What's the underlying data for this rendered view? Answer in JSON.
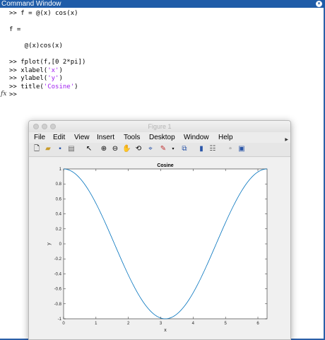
{
  "command_window": {
    "title": "Command Window",
    "lines": [
      {
        "prompt": ">> ",
        "code": "f = @(x) cos(x)",
        "str": ""
      },
      {
        "prompt": "",
        "code": "",
        "str": ""
      },
      {
        "prompt": "",
        "code": "f =",
        "str": ""
      },
      {
        "prompt": "",
        "code": "",
        "str": ""
      },
      {
        "prompt": "",
        "code": "    @(x)cos(x)",
        "str": ""
      },
      {
        "prompt": "",
        "code": "",
        "str": ""
      },
      {
        "prompt": ">> ",
        "code": "fplot(f,[0 2*pi])",
        "str": ""
      },
      {
        "prompt": ">> ",
        "code": "xlabel(",
        "str": "'x'",
        "tail": ")"
      },
      {
        "prompt": ">> ",
        "code": "ylabel(",
        "str": "'y'",
        "tail": ")"
      },
      {
        "prompt": ">> ",
        "code": "title(",
        "str": "'Cosine'",
        "tail": ")"
      },
      {
        "prompt": ">> ",
        "code": "",
        "str": ""
      }
    ],
    "fx_label": "fx"
  },
  "figure": {
    "title": "Figure 1",
    "menu": [
      "File",
      "Edit",
      "View",
      "Insert",
      "Tools",
      "Desktop",
      "Window",
      "Help"
    ],
    "toolbar_icons": [
      "new-figure-icon",
      "open-file-icon",
      "save-icon",
      "print-icon",
      "edit-plot-arrow-icon",
      "zoom-in-icon",
      "zoom-out-icon",
      "pan-hand-icon",
      "rotate-3d-icon",
      "data-cursor-icon",
      "brush-icon",
      "link-plot-icon",
      "colorbar-icon",
      "legend-icon",
      "hide-plot-tools-icon",
      "show-plot-tools-icon"
    ]
  },
  "chart_data": {
    "type": "line",
    "title": "Cosine",
    "xlabel": "x",
    "ylabel": "y",
    "xlim": [
      0,
      6.2832
    ],
    "ylim": [
      -1,
      1
    ],
    "xticks": [
      0,
      1,
      2,
      3,
      4,
      5,
      6
    ],
    "yticks": [
      -1,
      -0.8,
      -0.6,
      -0.4,
      -0.2,
      0,
      0.2,
      0.4,
      0.6,
      0.8,
      1
    ],
    "grid": false,
    "function": "cos(x)",
    "series": [
      {
        "color": "#0072bd",
        "x": [
          0,
          0.5,
          1,
          1.5,
          2,
          2.5,
          3,
          3.1416,
          3.5,
          4,
          4.5,
          5,
          5.5,
          6,
          6.2832
        ],
        "y": [
          1,
          0.878,
          0.54,
          0.071,
          -0.416,
          -0.801,
          -0.99,
          -1,
          -0.936,
          -0.654,
          -0.211,
          0.284,
          0.709,
          0.96,
          1
        ]
      }
    ]
  }
}
